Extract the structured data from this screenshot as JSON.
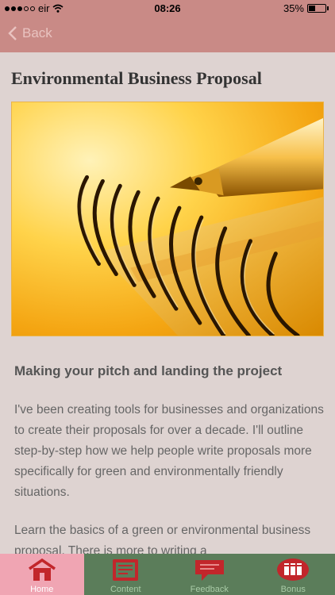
{
  "status": {
    "carrier": "eir",
    "time": "08:26",
    "battery_text": "35%",
    "battery_level": 0.35,
    "signal_filled": 3,
    "signal_total": 5
  },
  "nav": {
    "back_label": "Back"
  },
  "page": {
    "title": "Environmental Business Proposal",
    "subheading": "Making your pitch and landing the project",
    "paragraph1": "I've been creating tools for businesses and organizations to create their proposals for over a decade. I'll outline step-by-step how we help people write proposals more specifically for green and environmentally friendly situations.",
    "paragraph2": "Learn the basics of a green or environmental business proposal. There is more to writing a"
  },
  "tabs": [
    {
      "label": "Home",
      "icon": "home-icon",
      "active": true
    },
    {
      "label": "Content",
      "icon": "content-icon",
      "active": false
    },
    {
      "label": "Feedback",
      "icon": "feedback-icon",
      "active": false
    },
    {
      "label": "Bonus",
      "icon": "bonus-icon",
      "active": false
    }
  ],
  "colors": {
    "nav_background": "#c98a86",
    "page_background": "#ded3d1",
    "tabbar_background": "#5b7d5a",
    "active_tab": "#f0a5b3",
    "icon_red": "#c2262b"
  }
}
